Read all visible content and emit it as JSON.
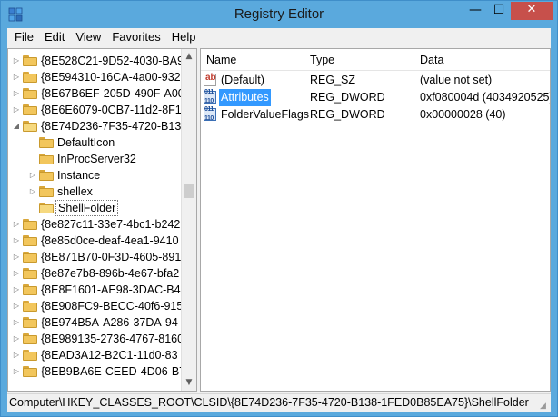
{
  "window": {
    "title": "Registry Editor",
    "icon": "registry-editor-icon",
    "controls": {
      "minimize": "—",
      "maximize": "☐",
      "close": "✕"
    }
  },
  "menu": [
    "File",
    "Edit",
    "View",
    "Favorites",
    "Help"
  ],
  "tree": {
    "items": [
      {
        "label": "{8E528C21-9D52-4030-BA9",
        "level": 0,
        "expander": "right"
      },
      {
        "label": "{8E594310-16CA-4a00-932",
        "level": 0,
        "expander": "right"
      },
      {
        "label": "{8E67B6EF-205D-490F-A00",
        "level": 0,
        "expander": "right"
      },
      {
        "label": "{8E6E6079-0CB7-11d2-8F1",
        "level": 0,
        "expander": "right"
      },
      {
        "label": "{8E74D236-7F35-4720-B13",
        "level": 0,
        "expander": "down"
      },
      {
        "label": "DefaultIcon",
        "level": 1,
        "expander": "none"
      },
      {
        "label": "InProcServer32",
        "level": 1,
        "expander": "none"
      },
      {
        "label": "Instance",
        "level": 1,
        "expander": "right"
      },
      {
        "label": "shellex",
        "level": 1,
        "expander": "right"
      },
      {
        "label": "ShellFolder",
        "level": 1,
        "expander": "none",
        "selected": true
      },
      {
        "label": "{8e827c11-33e7-4bc1-b242",
        "level": 0,
        "expander": "right"
      },
      {
        "label": "{8e85d0ce-deaf-4ea1-9410",
        "level": 0,
        "expander": "right"
      },
      {
        "label": "{8E871B70-0F3D-4605-891",
        "level": 0,
        "expander": "right"
      },
      {
        "label": "{8e87e7b8-896b-4e67-bfa2",
        "level": 0,
        "expander": "right"
      },
      {
        "label": "{8E8F1601-AE98-3DAC-B4",
        "level": 0,
        "expander": "right"
      },
      {
        "label": "{8E908FC9-BECC-40f6-915",
        "level": 0,
        "expander": "right"
      },
      {
        "label": "{8E974B5A-A286-37DA-94",
        "level": 0,
        "expander": "right"
      },
      {
        "label": "{8E989135-2736-4767-8160",
        "level": 0,
        "expander": "right"
      },
      {
        "label": "{8EAD3A12-B2C1-11d0-83",
        "level": 0,
        "expander": "right"
      },
      {
        "label": "{8EB9BA6E-CEED-4D06-B7",
        "level": 0,
        "expander": "right"
      }
    ]
  },
  "list": {
    "columns": {
      "name": "Name",
      "type": "Type",
      "data": "Data"
    },
    "rows": [
      {
        "icon": "string-value-icon",
        "glyph": "ab",
        "name": "(Default)",
        "type": "REG_SZ",
        "data": "(value not set)",
        "selected": false
      },
      {
        "icon": "binary-value-icon",
        "glyph": "011\n110",
        "name": "Attributes",
        "type": "REG_DWORD",
        "data": "0xf080004d (4034920525)",
        "selected": true
      },
      {
        "icon": "binary-value-icon",
        "glyph": "011\n110",
        "name": "FolderValueFlags",
        "type": "REG_DWORD",
        "data": "0x00000028 (40)",
        "selected": false
      }
    ]
  },
  "status": {
    "path": "Computer\\HKEY_CLASSES_ROOT\\CLSID\\{8E74D236-7F35-4720-B138-1FED0B85EA75}\\ShellFolder"
  },
  "colors": {
    "accent": "#5aa9dd",
    "close": "#c7504b",
    "selection": "#3399ff"
  }
}
